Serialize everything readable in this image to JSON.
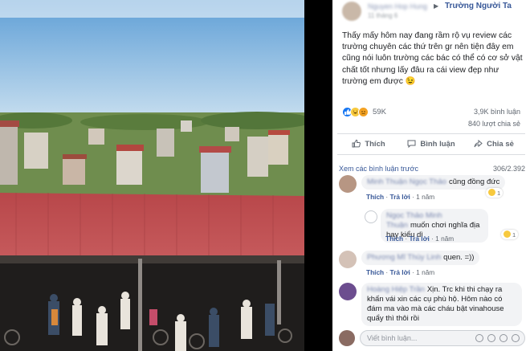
{
  "post": {
    "author": "Nguyen Hop Hung",
    "date": "11 tháng 6",
    "arrow": "▶",
    "group": "Trường Người Ta",
    "text": "Thấy mấy hôm nay đang rầm rộ vụ review các trường chuyên các thứ trên gr nên tiện đây em cũng nói luôn trường các bác có thể có cơ sở vật chất tốt nhưng lấy đâu ra cái view đẹp như trường em được 😉",
    "reaction_count": "59K",
    "comment_count": "3,9K bình luận",
    "share_count": "840 lượt chia sẻ",
    "reaction_icons": [
      "👍",
      "😆",
      "😢"
    ]
  },
  "actions": {
    "like": "Thích",
    "comment": "Bình luận",
    "share": "Chia sẻ"
  },
  "comments_header": {
    "more": "Xem các bình luận trước",
    "count": "306/2.392"
  },
  "comments": [
    {
      "name": "Minh Thuận Ngọc Thảo",
      "text": "cũng đồng đức",
      "like": "Thích",
      "reply": "Trả lời",
      "time": "1 năm",
      "reactions": "1"
    },
    {
      "name": "Ngọc Thảo Minh Thuận",
      "text": "muốn chơi nghĩa địa hay kiểu dì",
      "like": "Thích",
      "reply": "Trả lời",
      "time": "1 năm",
      "reactions": "1"
    },
    {
      "name": "Phương Mĩ Thùy Linh",
      "text": "quen. =))",
      "like": "Thích",
      "reply": "Trả lời",
      "time": "1 năm"
    },
    {
      "name": "Hoàng Hiệp Trần",
      "text": "Xịn. Trc khi thi chạy ra khấn vái xin các cụ phù hộ. Hôm nào có đám ma vào mà các cháu bật vinahouse quẩy thì thôi rồi",
      "like": "Thích",
      "reply": "Trả lời",
      "time": "1 năm"
    }
  ],
  "composer": {
    "placeholder": "Viết bình luận..."
  }
}
